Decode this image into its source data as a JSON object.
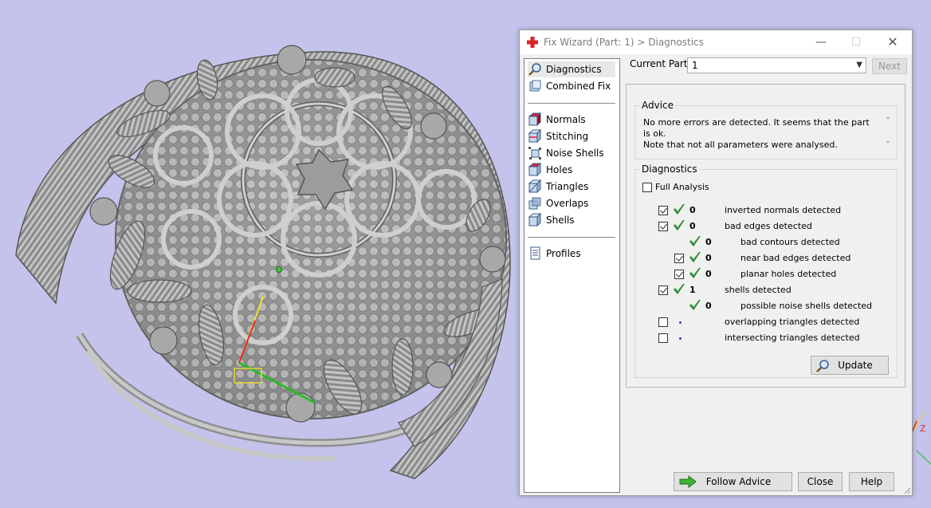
{
  "window": {
    "title": "Fix Wizard (Part: 1) > Diagnostics"
  },
  "nav": {
    "top": [
      {
        "label": "Diagnostics",
        "icon": "magnifier-icon",
        "selected": true
      },
      {
        "label": "Combined Fix",
        "icon": "combined-fix-icon"
      }
    ],
    "tools": [
      {
        "label": "Normals",
        "icon": "normals-icon"
      },
      {
        "label": "Stitching",
        "icon": "stitching-icon"
      },
      {
        "label": "Noise Shells",
        "icon": "noise-shells-icon"
      },
      {
        "label": "Holes",
        "icon": "holes-icon"
      },
      {
        "label": "Triangles",
        "icon": "triangles-icon"
      },
      {
        "label": "Overlaps",
        "icon": "overlaps-icon"
      },
      {
        "label": "Shells",
        "icon": "shells-icon"
      }
    ],
    "bottom": [
      {
        "label": "Profiles",
        "icon": "profiles-icon"
      }
    ]
  },
  "part": {
    "label": "Current Part:",
    "value": "1"
  },
  "next_label": "Next",
  "advice": {
    "title": "Advice",
    "line1": "No more errors are detected. It seems that the part is ok.",
    "line2": "Note that not all parameters were analysed."
  },
  "diagnostics": {
    "title": "Diagnostics",
    "full_analysis": "Full Analysis",
    "rows": [
      {
        "checked": true,
        "status": "ok",
        "count": "0",
        "label": "inverted normals detected",
        "indent": 0
      },
      {
        "checked": true,
        "status": "ok",
        "count": "0",
        "label": "bad edges detected",
        "indent": 0
      },
      {
        "checked": null,
        "status": "ok",
        "count": "0",
        "label": "bad contours detected",
        "indent": 1
      },
      {
        "checked": true,
        "status": "ok",
        "count": "0",
        "label": "near bad edges detected",
        "indent": 1
      },
      {
        "checked": true,
        "status": "ok",
        "count": "0",
        "label": "planar holes detected",
        "indent": 1
      },
      {
        "checked": true,
        "status": "ok",
        "count": "1",
        "label": "shells detected",
        "indent": 0
      },
      {
        "checked": null,
        "status": "ok",
        "count": "0",
        "label": "possible noise shells detected",
        "indent": 1
      },
      {
        "checked": false,
        "status": "pending",
        "count": "",
        "label": "overlapping triangles detected",
        "indent": 0
      },
      {
        "checked": false,
        "status": "pending",
        "count": "",
        "label": "intersecting triangles detected",
        "indent": 0
      }
    ],
    "update_label": "Update"
  },
  "buttons": {
    "follow_advice": "Follow Advice",
    "close": "Close",
    "help": "Help"
  },
  "axis": {
    "z": "Z"
  },
  "colors": {
    "viewport_bg": "#c3c3ec",
    "ok_green": "#2e8b2e",
    "model_gray": "#9a9a9a"
  }
}
